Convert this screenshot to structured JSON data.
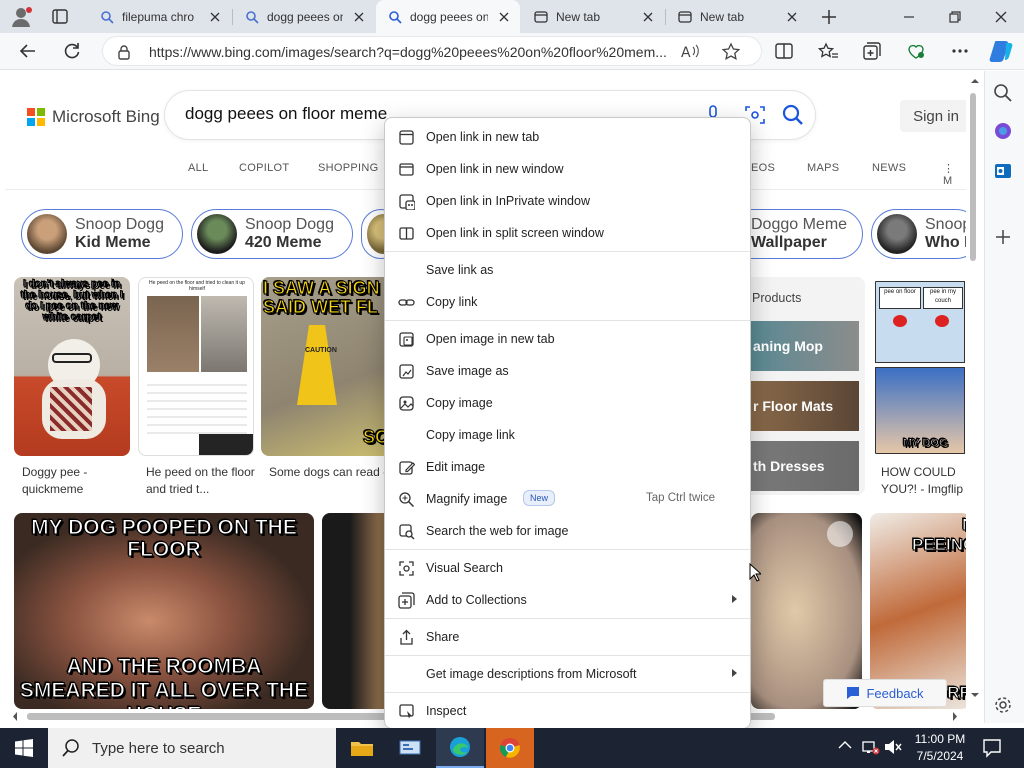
{
  "tabs": [
    {
      "title": "filepuma chro",
      "icon": "search-icon"
    },
    {
      "title": "dogg peees on",
      "icon": "search-icon"
    },
    {
      "title": "dogg peees on",
      "icon": "search-icon",
      "active": true
    },
    {
      "title": "New tab",
      "icon": "newtab-icon"
    },
    {
      "title": "New tab",
      "icon": "newtab-icon"
    }
  ],
  "address": {
    "url": "https://www.bing.com/images/search?q=dogg%20peees%20on%20floor%20mem..."
  },
  "bing": {
    "logo": "Microsoft Bing",
    "query": "dogg peees on floor meme",
    "signin": "Sign in",
    "nav": [
      "ALL",
      "COPILOT",
      "SHOPPING",
      "EOS",
      "MAPS",
      "NEWS",
      "M"
    ]
  },
  "pills": [
    {
      "l1": "Snoop Dogg",
      "l2": "Kid Meme"
    },
    {
      "l1": "Snoop Dogg",
      "l2": "420 Meme"
    },
    {
      "l1": "Doggo Meme",
      "l2": "Wallpaper"
    },
    {
      "l1": "Snoop",
      "l2": "Who I"
    }
  ],
  "images": {
    "img1_text": "I don't always pee in the house, but when I do I pee on the new white carpet",
    "img1_cap": "Doggy pee - quickmeme",
    "img2_top": "He peed on the floor and tried to clean it up himself",
    "img2_cap": "He peed on the floor and tried t...",
    "img3_top": "I SAW A SIGN SAID WET FL",
    "img3_sign": "CAUTION",
    "img3_bottom": "SO",
    "img3_cap": "Some dogs can read -",
    "products_title": "Products",
    "products": [
      "aning Mop",
      "r Floor Mats",
      "th Dresses"
    ],
    "img5_btn1": "pee on floor",
    "img5_btn2": "pee in my couch",
    "img5_bottom": "MY DOG",
    "img5_cap": "HOW COULD YOU?! - Imgflip",
    "meme_big_top": "MY DOG POOPED ON THE FLOOR",
    "meme_big_bottom": "AND THE ROOMBA SMEARED IT ALL OVER THE HOUSE",
    "meme_right_top": "PEEING",
    "meme_right_bottom": "ORR"
  },
  "feedback": "Feedback",
  "context_menu": {
    "items": [
      {
        "label": "Open link in new tab",
        "icon": "newtab-icon"
      },
      {
        "label": "Open link in new window",
        "icon": "window-icon"
      },
      {
        "label": "Open link in InPrivate window",
        "icon": "inprivate-icon"
      },
      {
        "label": "Open link in split screen window",
        "icon": "split-screen-icon"
      },
      {
        "label": "Save link as",
        "icon": ""
      },
      {
        "label": "Copy link",
        "icon": "link-icon"
      },
      {
        "label": "Open image in new tab",
        "icon": "image-newtab-icon"
      },
      {
        "label": "Save image as",
        "icon": "save-image-icon"
      },
      {
        "label": "Copy image",
        "icon": "copy-image-icon"
      },
      {
        "label": "Copy image link",
        "icon": ""
      },
      {
        "label": "Edit image",
        "icon": "edit-image-icon"
      },
      {
        "label": "Magnify image",
        "icon": "magnify-icon",
        "badge": "New",
        "shortcut": "Tap Ctrl twice"
      },
      {
        "label": "Search the web for image",
        "icon": "search-image-icon"
      },
      {
        "label": "Visual Search",
        "icon": "visual-search-icon"
      },
      {
        "label": "Add to Collections",
        "icon": "collections-icon",
        "submenu": true
      },
      {
        "label": "Share",
        "icon": "share-icon"
      },
      {
        "label": "Get image descriptions from Microsoft",
        "icon": "",
        "submenu": true
      },
      {
        "label": "Inspect",
        "icon": "inspect-icon"
      }
    ]
  },
  "taskbar": {
    "search_placeholder": "Type here to search",
    "time": "11:00 PM",
    "date": "7/5/2024"
  },
  "colors": {
    "accent": "#0067c0",
    "bing_blue": "#1a56db",
    "taskbar": "#1c2434"
  }
}
